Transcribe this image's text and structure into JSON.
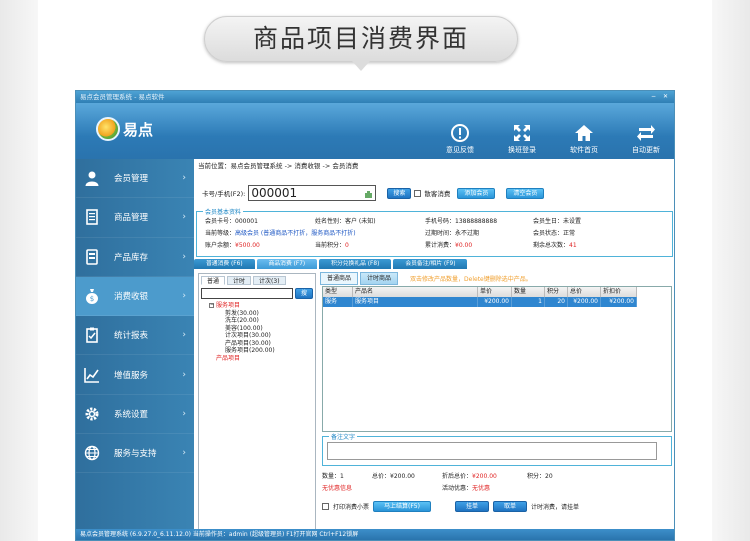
{
  "banner": "商品项目消费界面",
  "window": {
    "title": "易点会员管理系统 - 易点软件"
  },
  "logo": {
    "text": "易点"
  },
  "tools": [
    {
      "label": "意见反馈",
      "icon": "feedback-icon"
    },
    {
      "label": "换班登录",
      "icon": "switch-login-icon"
    },
    {
      "label": "软件首页",
      "icon": "home-icon"
    },
    {
      "label": "自动更新",
      "icon": "update-icon"
    }
  ],
  "sidebar": {
    "items": [
      {
        "label": "会员管理",
        "icon": "user-icon"
      },
      {
        "label": "商品管理",
        "icon": "document-icon"
      },
      {
        "label": "产品库存",
        "icon": "storage-icon"
      },
      {
        "label": "消费收银",
        "icon": "moneybag-icon",
        "active": true
      },
      {
        "label": "统计报表",
        "icon": "clipboard-icon"
      },
      {
        "label": "增值服务",
        "icon": "chart-icon"
      },
      {
        "label": "系统设置",
        "icon": "gear-icon"
      },
      {
        "label": "服务与支持",
        "icon": "globe-icon"
      }
    ]
  },
  "breadcrumb": "当前位置：易点会员管理系统 -> 消费收银 -> 会员消费",
  "search": {
    "label": "卡号/手机(F2):",
    "value": "000001",
    "search_btn": "搜索",
    "walkin_label": "散客消费",
    "add_member_btn": "添加会员",
    "clear_member_btn": "清空会员"
  },
  "member": {
    "section_title": "会员基本资料",
    "card_no_label": "会员卡号：",
    "card_no": "000001",
    "name_label": "姓名性别：",
    "name": "客户 (未知)",
    "phone_label": "手机号码：",
    "phone": "13888888888",
    "birthday_label": "会员生日：",
    "birthday": "未设置",
    "level_label": "当前等级：",
    "level": "高级会员 (普通商品不打折，服务商品不打折)",
    "expire_label": "过期时间：",
    "expire": "永不过期",
    "status_label": "会员状态：",
    "status": "正常",
    "balance_label": "账户余额：",
    "balance": "¥500.00",
    "points_label": "当前积分：",
    "points": "0",
    "total_label": "累计消费：",
    "total": "¥0.00",
    "remain_label": "剩余总次数：",
    "remain": "41"
  },
  "main_tabs": [
    "普通消费 (F6)",
    "商品消费 (F7)",
    "积分兑换礼品 (F8)",
    "会员备注/相片 (F9)"
  ],
  "left_tabs": [
    "普通",
    "计时",
    "计次(3)"
  ],
  "left_search_btn": "搜",
  "tree": {
    "root": "服务项目",
    "children": [
      "剪发(30.00)",
      "洗车(20.00)",
      "美容(100.00)",
      "计次项目(30.00)",
      "产品项目(30.00)",
      "服务项目(200.00)"
    ],
    "root2": "产品项目"
  },
  "right_tabs": [
    "普通商品",
    "计时商品"
  ],
  "right_hint": "双击修改产品数量，Delete键删除选中产品。",
  "table": {
    "headers": [
      "类型",
      "产品名",
      "单价",
      "数量",
      "积分",
      "总价",
      "折扣价"
    ],
    "rows": [
      [
        "服务",
        "服务项目",
        "¥200.00",
        "1",
        "20",
        "¥200.00",
        "¥200.00"
      ]
    ]
  },
  "remark": {
    "title": "备注文字"
  },
  "summary": {
    "qty_label": "数量：",
    "qty": "1",
    "total_label": "总价：",
    "total": "¥200.00",
    "discount_label": "折后总价：",
    "discount": "¥200.00",
    "points_label": "积分：",
    "points": "20",
    "info_label": "无优惠信息",
    "promo_label": "活动优惠：",
    "promo": "无优惠"
  },
  "bottom": {
    "print_label": "打印消费小票",
    "checkout_btn": "马上结算(F5)",
    "hang_btn": "挂单",
    "take_btn": "取单",
    "timing_text": "计时消费，请挂单"
  },
  "statusbar": "易点会员管理系统 (6.9.27.0_6.11.12.0)   当前操作员：admin (超级管理员)  F1打开官网 Ctrl+F12锁屏"
}
